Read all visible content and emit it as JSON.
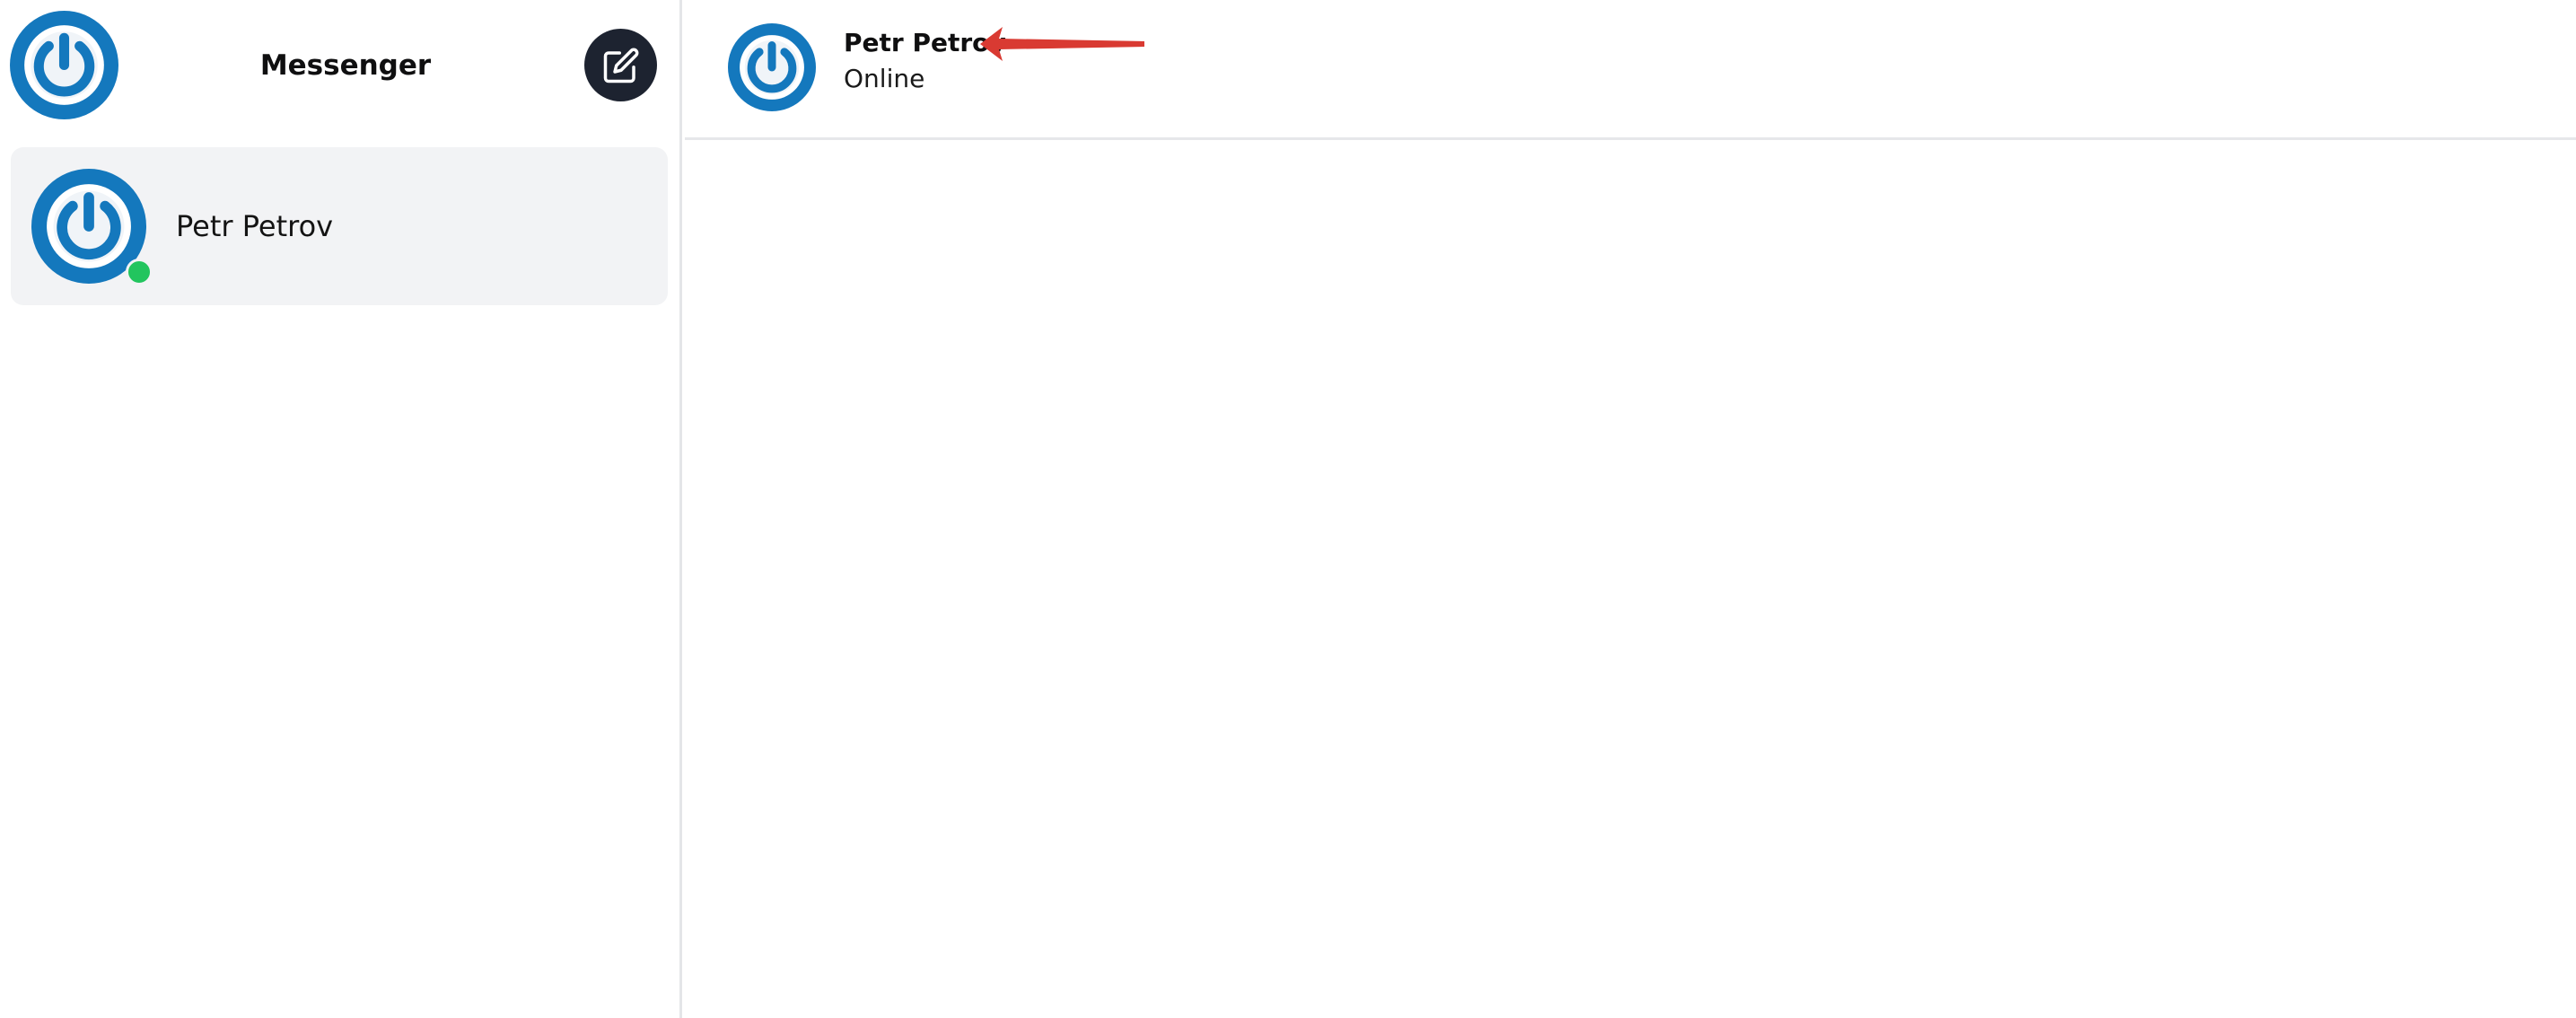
{
  "sidebar": {
    "app_title": "Messenger",
    "logo_icon": "power-logo-icon",
    "compose_icon": "edit-icon",
    "conversations": [
      {
        "name": "Petr Petrov",
        "avatar_icon": "power-logo-icon",
        "status": "online"
      }
    ]
  },
  "chat": {
    "contact_name": "Petr Petrov",
    "contact_status": "Online",
    "avatar_icon": "power-logo-icon"
  },
  "annotation": {
    "icon": "red-arrow-icon"
  },
  "colors": {
    "brand_blue": "#1478bd",
    "compose_button_bg": "#1d2330",
    "online_green": "#22c55e",
    "selected_item_bg": "#f2f3f5",
    "annotation_red": "#d93a32"
  }
}
